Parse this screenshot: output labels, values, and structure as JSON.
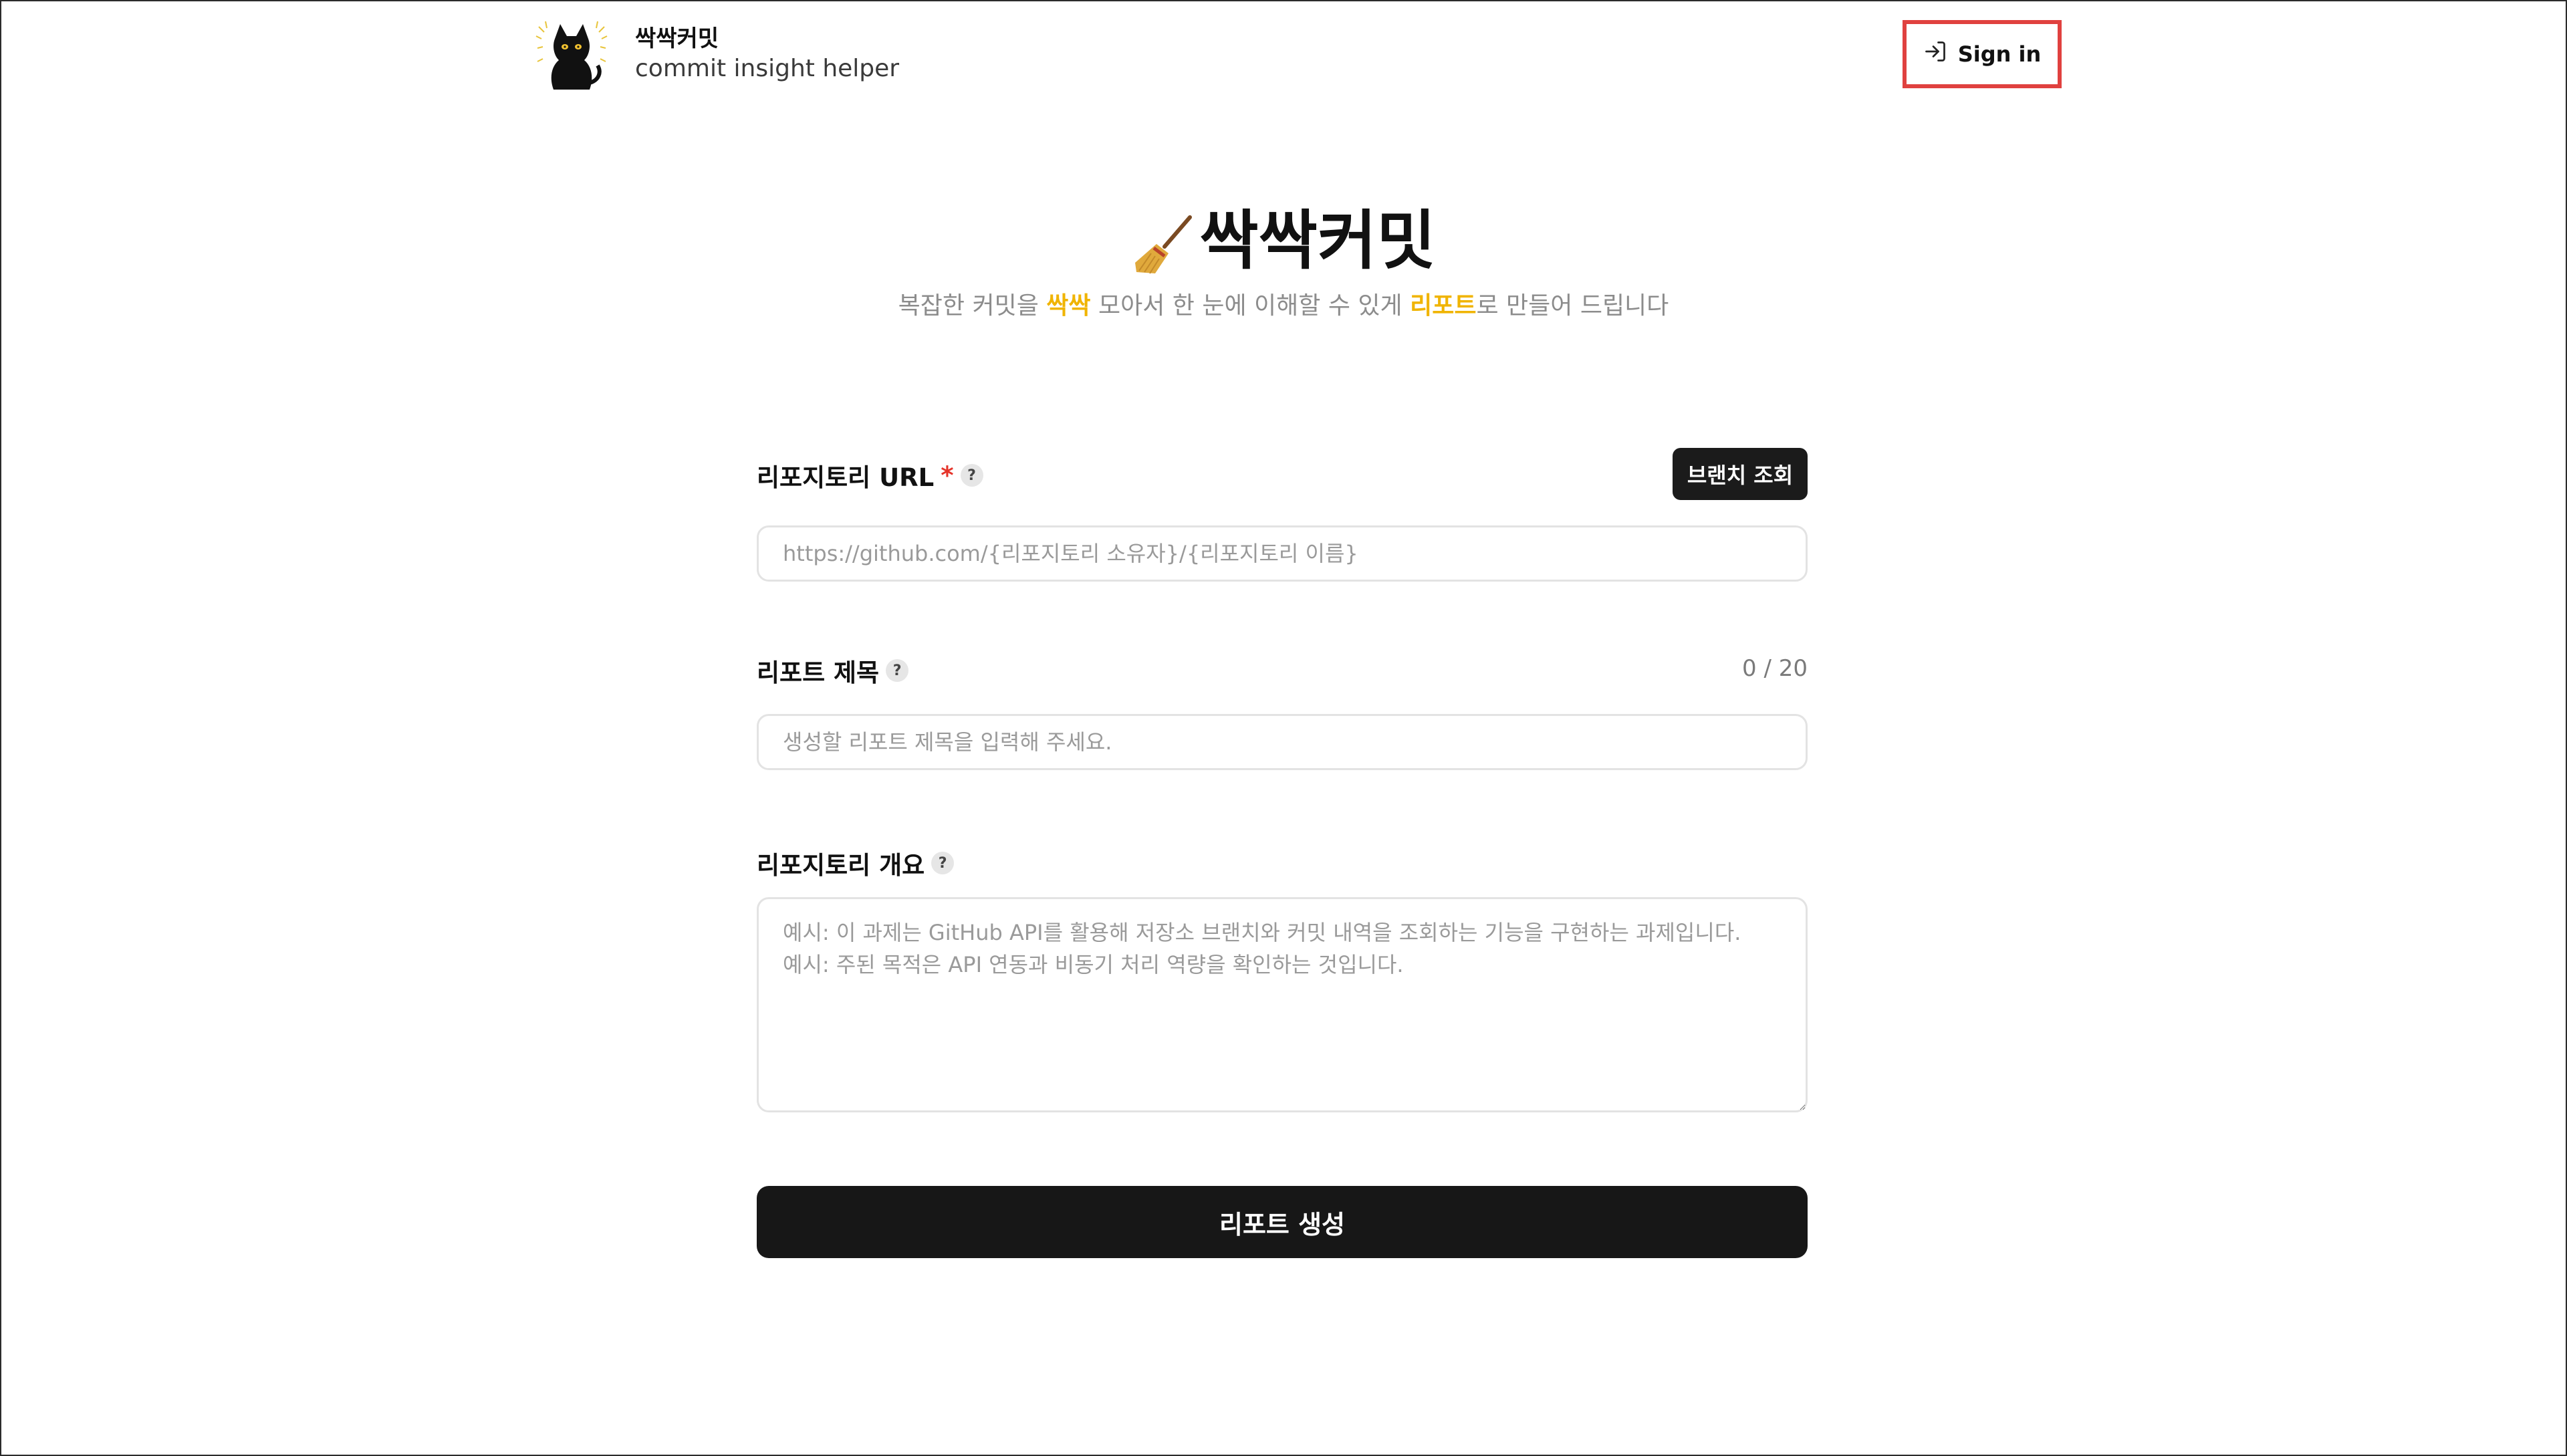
{
  "header": {
    "brand_name": "싹싹커밋",
    "brand_subtitle": "commit insight helper",
    "logo_icon": "black-cat-logo",
    "signin_label": "Sign in",
    "signin_icon": "sign-in-icon",
    "highlight_color": "#e0413f"
  },
  "hero": {
    "icon": "broom-icon",
    "title": "싹싹커밋",
    "subtitle_parts": [
      "복잡한 커밋을 ",
      "싹싹",
      " 모아서 한 눈에 이해할 수 있게 ",
      "리포트",
      "로 만들어 드립니다"
    ],
    "accent_color": "#f0b400"
  },
  "form": {
    "repo_url": {
      "label": "리포지토리 URL",
      "required_mark": "*",
      "help": "?",
      "branch_button": "브랜치 조회",
      "value": "",
      "placeholder": "https://github.com/{리포지토리 소유자}/{리포지토리 이름}"
    },
    "report_title": {
      "label": "리포트 제목",
      "help": "?",
      "counter": "0 / 20",
      "value": "",
      "placeholder": "생성할 리포트 제목을 입력해 주세요."
    },
    "repo_overview": {
      "label": "리포지토리 개요",
      "help": "?",
      "value": "",
      "placeholder": "예시: 이 과제는 GitHub API를 활용해 저장소 브랜치와 커밋 내역을 조회하는 기능을 구현하는 과제입니다.\n예시: 주된 목적은 API 연동과 비동기 처리 역량을 확인하는 것입니다."
    },
    "submit_label": "리포트 생성"
  }
}
